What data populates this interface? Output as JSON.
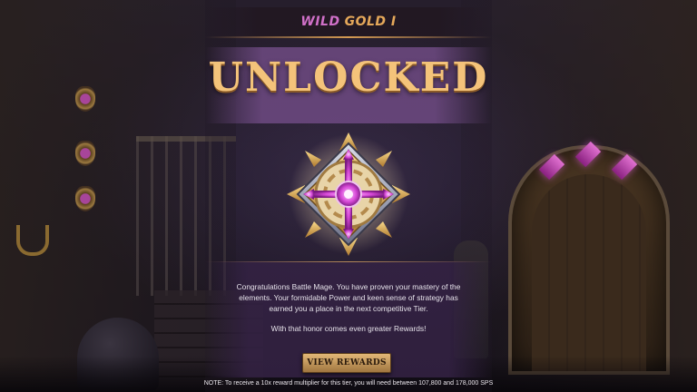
{
  "tier": {
    "word1": "WILD",
    "word2": "GOLD I"
  },
  "headline": "UNLOCKED",
  "badge": {
    "icon": "tier-medal-icon"
  },
  "message": {
    "paragraph1": "Congratulations Battle Mage. You have proven your mastery of the elements. Your formidable Power and keen sense of strategy has earned you a place in the next competitive Tier.",
    "paragraph2": "With that honor comes even greater Rewards!"
  },
  "button": {
    "label": "VIEW REWARDS"
  },
  "note": "NOTE: To receive a 10x reward multiplier for this tier, you will need between 107,800 and 178,000 SPS",
  "colors": {
    "tier_purple": "#d070c8",
    "tier_gold": "#e5a85a",
    "headline_gold": "#f4c37a",
    "button_gold": "#e2b777"
  }
}
